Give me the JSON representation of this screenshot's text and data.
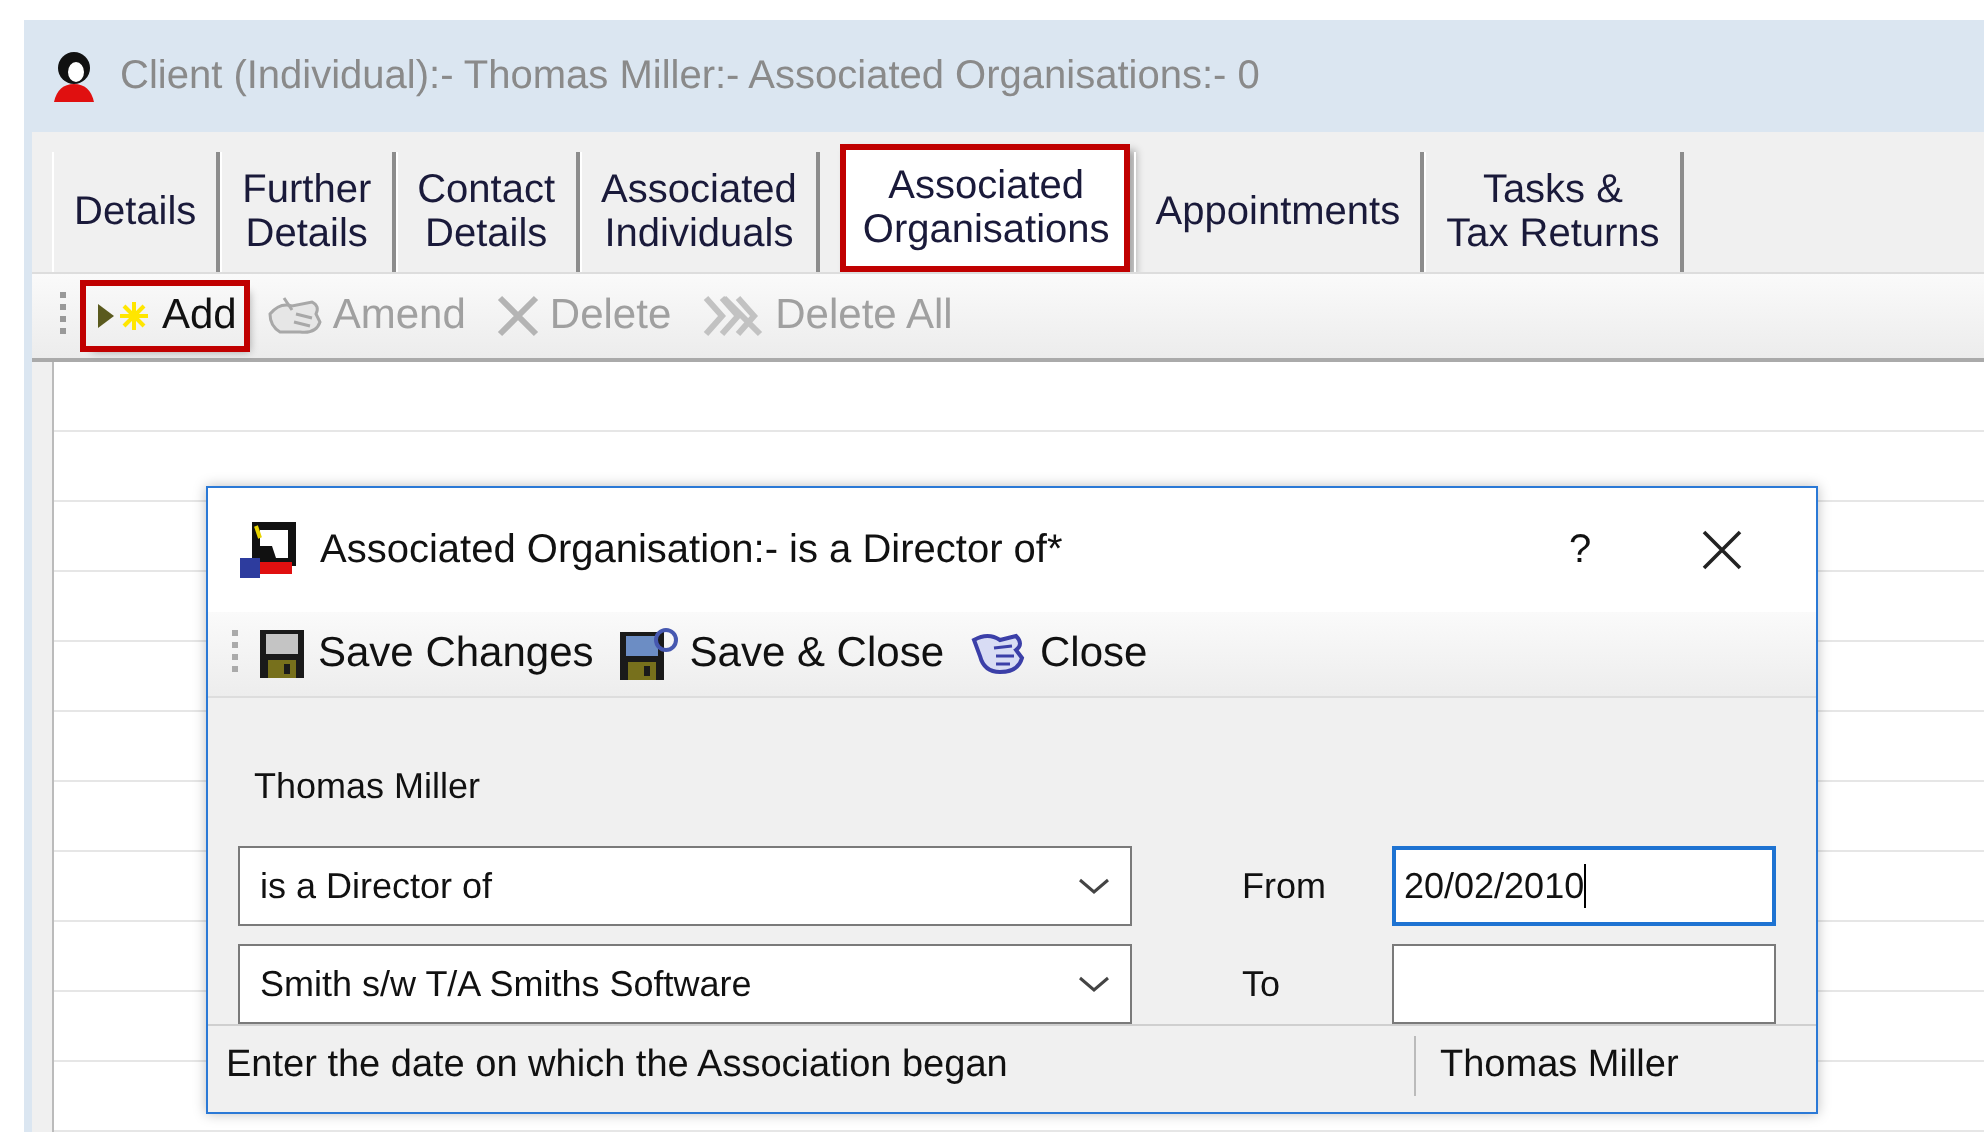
{
  "window": {
    "title": "Client (Individual):- Thomas Miller:- Associated Organisations:- 0"
  },
  "tabs": [
    {
      "label": "Details",
      "selected": false,
      "highlighted": false
    },
    {
      "label": "Further\nDetails",
      "selected": false,
      "highlighted": false
    },
    {
      "label": "Contact\nDetails",
      "selected": false,
      "highlighted": false
    },
    {
      "label": "Associated\nIndividuals",
      "selected": false,
      "highlighted": false
    },
    {
      "label": "Associated\nOrganisations",
      "selected": true,
      "highlighted": true
    },
    {
      "label": "Appointments",
      "selected": false,
      "highlighted": false
    },
    {
      "label": "Tasks &\nTax Returns",
      "selected": false,
      "highlighted": false
    }
  ],
  "toolbar": [
    {
      "kind": "add",
      "label": "Add",
      "disabled": false,
      "highlighted": true
    },
    {
      "kind": "amend",
      "label": "Amend",
      "disabled": true,
      "highlighted": false
    },
    {
      "kind": "delete",
      "label": "Delete",
      "disabled": true,
      "highlighted": false
    },
    {
      "kind": "delete_all",
      "label": "Delete All",
      "disabled": true,
      "highlighted": false
    }
  ],
  "dialog": {
    "title": "Associated Organisation:- is a Director of*",
    "help": "?",
    "toolbar": [
      {
        "kind": "save",
        "label": "Save Changes"
      },
      {
        "kind": "save_close",
        "label": "Save & Close"
      },
      {
        "kind": "close",
        "label": "Close"
      }
    ],
    "person": "Thomas Miller",
    "relationship": {
      "value": "is a Director of"
    },
    "organisation": {
      "value": "Smith s/w T/A Smiths Software"
    },
    "from": {
      "label": "From",
      "value": "20/02/2010",
      "focused": true
    },
    "to": {
      "label": "To",
      "focused": false
    },
    "status_bar": [
      "Enter the date on which the Association began",
      "Thomas Miller"
    ]
  }
}
